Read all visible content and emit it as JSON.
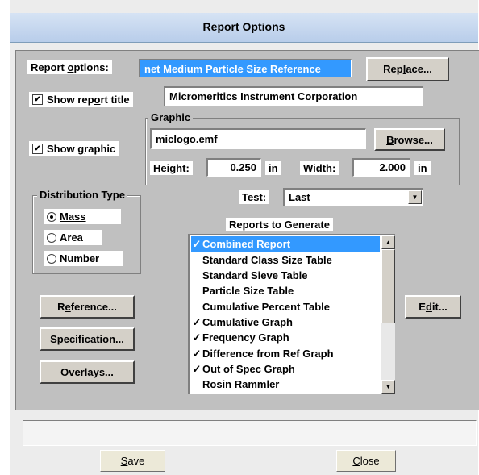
{
  "dialog": {
    "title": "Report Options"
  },
  "report_options": {
    "label": "Report options:",
    "value": "net Medium Particle Size Reference",
    "replace_button": "Replace..."
  },
  "show_report_title": {
    "label": "Show report title",
    "checked": true,
    "value": "Micromeritics Instrument Corporation"
  },
  "show_graphic": {
    "label": "Show graphic",
    "checked": true
  },
  "graphic": {
    "group_label": "Graphic",
    "file": "miclogo.emf",
    "browse_button": "Browse...",
    "height_label": "Height:",
    "height_value": "0.250",
    "height_unit": "in",
    "width_label": "Width:",
    "width_value": "2.000",
    "width_unit": "in"
  },
  "distribution_type": {
    "label": "Distribution Type",
    "options": [
      {
        "label": "Mass",
        "selected": true
      },
      {
        "label": "Area",
        "selected": false
      },
      {
        "label": "Number",
        "selected": false
      }
    ]
  },
  "test": {
    "label": "Test:",
    "value": "Last"
  },
  "reports": {
    "label": "Reports to Generate",
    "items": [
      {
        "label": "Combined Report",
        "checked": true,
        "selected": true
      },
      {
        "label": "Standard Class Size Table",
        "checked": false,
        "selected": false
      },
      {
        "label": "Standard Sieve Table",
        "checked": false,
        "selected": false
      },
      {
        "label": "Particle Size Table",
        "checked": false,
        "selected": false
      },
      {
        "label": "Cumulative Percent Table",
        "checked": false,
        "selected": false
      },
      {
        "label": "Cumulative Graph",
        "checked": true,
        "selected": false
      },
      {
        "label": "Frequency Graph",
        "checked": true,
        "selected": false
      },
      {
        "label": "Difference from Ref Graph",
        "checked": true,
        "selected": false
      },
      {
        "label": "Out of Spec Graph",
        "checked": true,
        "selected": false
      },
      {
        "label": "Rosin Rammler",
        "checked": false,
        "selected": false
      }
    ],
    "edit_button": "Edit..."
  },
  "side_buttons": {
    "reference": "Reference...",
    "specification": "Specification...",
    "overlays": "Overlays..."
  },
  "footer": {
    "save": "Save",
    "close": "Close",
    "status_text": ""
  },
  "icons": {
    "check": "✓",
    "checkbox_mark": "✔",
    "arrow_up": "▲",
    "arrow_down": "▼"
  }
}
